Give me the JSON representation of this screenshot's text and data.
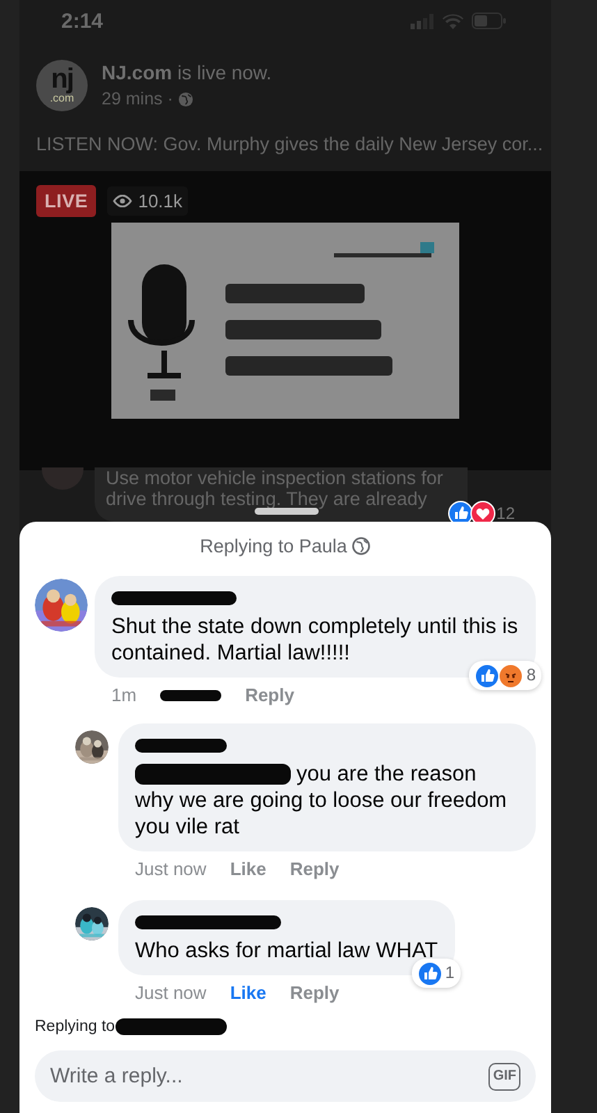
{
  "status_bar": {
    "time": "2:14"
  },
  "post": {
    "logo": {
      "mark": "nj",
      "suffix": ".com"
    },
    "author_line": "**NJ.com** is live now.",
    "time": "29 mins ·",
    "text": "LISTEN NOW: Gov. Murphy gives the daily New Jersey cor...",
    "live_badge": "LIVE",
    "viewers": "10.1k"
  },
  "background_comment": {
    "lines": [
      "Use motor vehicle inspection stations for",
      "drive through testing. They are already"
    ],
    "reactions": {
      "icons": [
        {
          "kind": "like"
        },
        {
          "kind": "love"
        }
      ],
      "count": "12"
    }
  },
  "sheet": {
    "title": "Replying to Paula",
    "comments": [
      {
        "name_redacted": true,
        "mention_redacted": false,
        "text": "Shut the state down completely until this is contained. Martial law!!!!!",
        "time": "1m",
        "actions_redacted": true,
        "reply": "Reply",
        "reactions": {
          "icons": [
            {
              "kind": "like"
            },
            {
              "kind": "angry"
            }
          ],
          "count": "8"
        },
        "children": [
          {
            "name_redacted": true,
            "mention_redacted": true,
            "text": "you are the reason why we are going to loose our freedom you vile rat",
            "time": "Just now",
            "like": {
              "label": "Like",
              "selected": false
            },
            "reply": "Reply"
          },
          {
            "name_redacted": true,
            "mention_redacted": false,
            "text": "Who asks for martial law WHAT",
            "time": "Just now",
            "like": {
              "label": "Like",
              "selected": true
            },
            "reply": "Reply",
            "reactions": {
              "icons": [
                {
                  "kind": "like"
                }
              ],
              "count": "1"
            }
          }
        ]
      }
    ]
  },
  "composer": {
    "replying_label": "Replying to",
    "target_redacted": true,
    "placeholder": "Write a reply...",
    "gif_label": "GIF"
  }
}
